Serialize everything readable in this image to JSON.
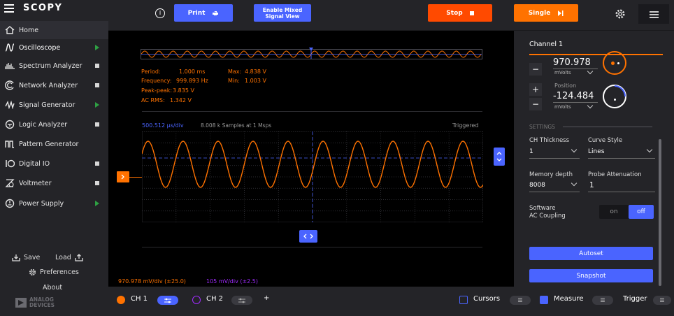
{
  "app": {
    "name": "SCOPY"
  },
  "sidebar": {
    "home": "Home",
    "items": [
      {
        "label": "Oscilloscope",
        "icon": "oscilloscope-icon",
        "status": "run"
      },
      {
        "label": "Spectrum Analyzer",
        "icon": "spectrum-icon",
        "status": "stop"
      },
      {
        "label": "Network Analyzer",
        "icon": "network-icon",
        "status": "stop"
      },
      {
        "label": "Signal Generator",
        "icon": "signal-icon",
        "status": "run"
      },
      {
        "label": "Logic Analyzer",
        "icon": "logic-icon",
        "status": "stop"
      },
      {
        "label": "Pattern Generator",
        "icon": "pattern-icon",
        "status": ""
      },
      {
        "label": "Digital IO",
        "icon": "digital-io-icon",
        "status": "stop"
      },
      {
        "label": "Voltmeter",
        "icon": "voltmeter-icon",
        "status": "stop"
      },
      {
        "label": "Power Supply",
        "icon": "power-icon",
        "status": "run"
      }
    ],
    "save": "Save",
    "load": "Load",
    "preferences": "Preferences",
    "about": "About",
    "vendor_line1": "ANALOG",
    "vendor_line2": "DEVICES"
  },
  "toolbar": {
    "info": "i",
    "print": "Print",
    "mixed_line1": "Enable Mixed",
    "mixed_line2": "Signal View",
    "stop": "Stop",
    "single": "Single"
  },
  "measurements": {
    "period_label": "Period:",
    "period_value": "1.000 ms",
    "max_label": "Max:",
    "max_value": "4.838 V",
    "freq_label": "Frequency:",
    "freq_value": "999.893 Hz",
    "min_label": "Min:",
    "min_value": "1.003 V",
    "pp_label": "Peak-peak:",
    "pp_value": "3.835 V",
    "rms_label": "AC RMS:",
    "rms_value": "1.342 V"
  },
  "plot": {
    "timebase": "500.512 µs/div",
    "samples": "8.008 k Samples at 1 Msps",
    "status": "Triggered",
    "ch1_scale": "970.978 mV/div (±25.0)",
    "ch2_scale": "105 mV/div (±2.5)"
  },
  "channel_panel": {
    "title": "Channel 1",
    "volts_div_value": "970.978",
    "volts_div_unit": "mVolts",
    "position_label": "Position",
    "position_value": "-124.484",
    "position_unit": "mVolts",
    "settings_label": "SETTINGS",
    "thickness_label": "CH Thickness",
    "thickness_value": "1",
    "curve_label": "Curve Style",
    "curve_value": "Lines",
    "memory_label": "Memory depth",
    "memory_value": "8008",
    "probe_label": "Probe Attenuation",
    "probe_value": "1",
    "coupling_line1": "Software",
    "coupling_line2": "AC Coupling",
    "toggle_on": "on",
    "toggle_off": "off",
    "autoset": "Autoset",
    "snapshot": "Snapshot"
  },
  "bottombar": {
    "ch1": "CH 1",
    "ch2": "CH 2",
    "add": "+",
    "cursors": "Cursors",
    "measure": "Measure",
    "trigger": "Trigger"
  },
  "colors": {
    "accent": "#4a64ff",
    "ch1": "#ff7200",
    "ch2": "#a02bff",
    "stop_button": "#ff4a00",
    "single_button": "#ff7200",
    "running": "#2ea043"
  }
}
